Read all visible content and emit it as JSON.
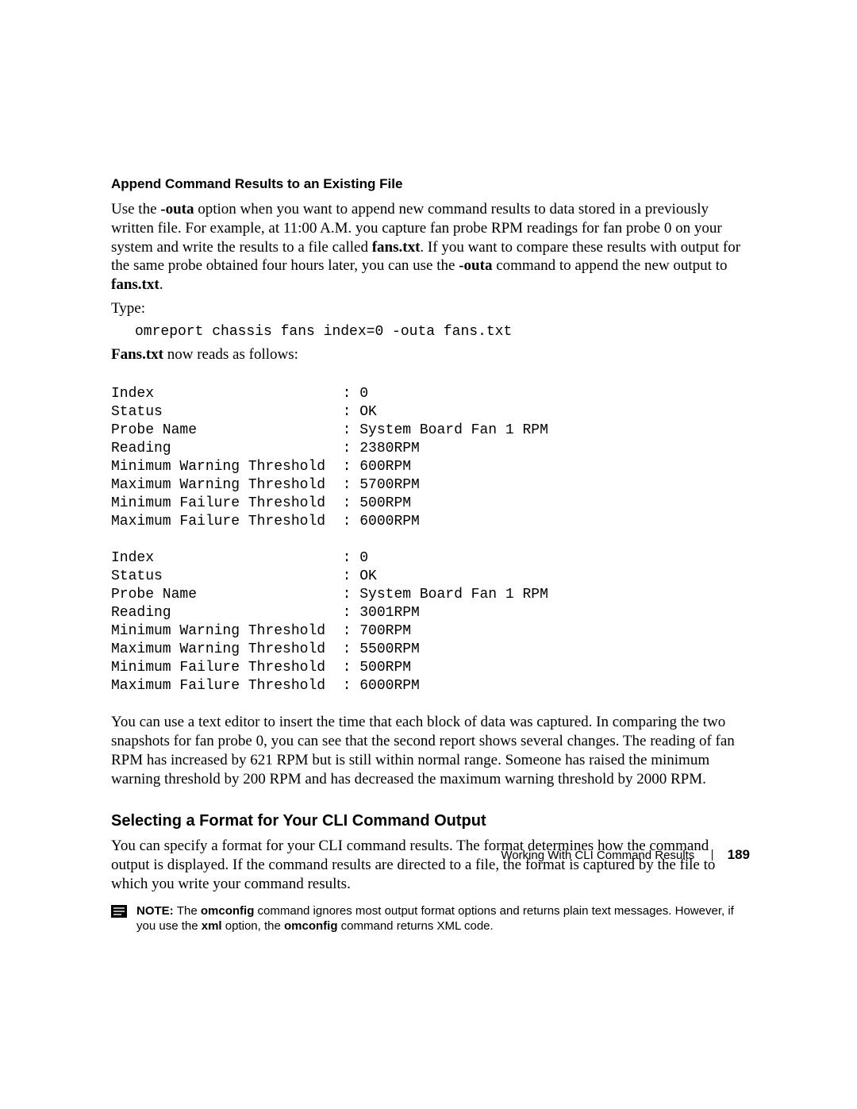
{
  "heading_append": "Append Command Results to an Existing File",
  "p1": {
    "pre1": "Use the ",
    "b1": "-outa",
    "mid1": " option when you want to append new command results to data stored in a previously written file. For example, at 11:00 A.M. you capture fan probe RPM readings for fan probe 0 on your system and write the results to a file called ",
    "b2": "fans.txt",
    "mid2": ". If you want to compare these results with output for the same probe obtained four hours later, you can use the ",
    "b3": "-outa",
    "mid3": " command to append the new output to ",
    "b4": "fans.txt",
    "post": "."
  },
  "type_label": "Type:",
  "cmd1": "omreport chassis fans index=0 -outa fans.txt",
  "p2": {
    "b1": "Fans.txt",
    "rest": " now reads as follows:"
  },
  "block": "Index                      : 0\nStatus                     : OK\nProbe Name                 : System Board Fan 1 RPM\nReading                    : 2380RPM\nMinimum Warning Threshold  : 600RPM\nMaximum Warning Threshold  : 5700RPM\nMinimum Failure Threshold  : 500RPM\nMaximum Failure Threshold  : 6000RPM\n\nIndex                      : 0\nStatus                     : OK\nProbe Name                 : System Board Fan 1 RPM\nReading                    : 3001RPM\nMinimum Warning Threshold  : 700RPM\nMaximum Warning Threshold  : 5500RPM\nMinimum Failure Threshold  : 500RPM\nMaximum Failure Threshold  : 6000RPM",
  "p3": "You can use a text editor to insert the time that each block of data was captured. In comparing the two snapshots for fan probe 0, you can see that the second report shows several changes. The reading of fan RPM has increased by 621 RPM but is still within normal range. Someone has raised the minimum warning threshold by 200 RPM and has decreased the maximum warning threshold by 2000 RPM.",
  "heading_format": "Selecting a Format for Your CLI Command Output",
  "p4": "You can specify a format for your CLI command results. The format determines how the command output is displayed. If the command results are directed to a file, the format is captured by the file to which you write your command results.",
  "note": {
    "label": "NOTE: ",
    "t1": "The ",
    "b1": "omconfig",
    "t2": " command ignores most output format options and returns plain text messages. However, if you use the ",
    "b2": "xml",
    "t3": " option, the ",
    "b3": "omconfig",
    "t4": " command returns XML code."
  },
  "footer": {
    "section": "Working With CLI Command Results",
    "page": "189"
  }
}
